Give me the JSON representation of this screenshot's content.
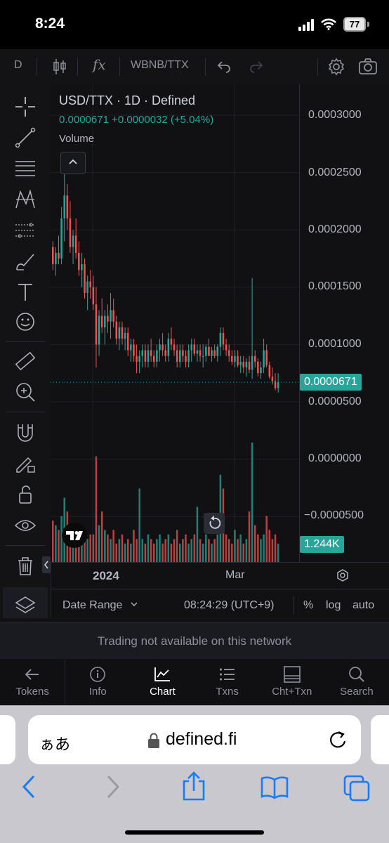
{
  "status": {
    "time": "8:24",
    "battery": "77"
  },
  "toolbar": {
    "interval": "D",
    "fx": "fx",
    "symbol": "WBNB/TTX"
  },
  "legend": {
    "title": "USD/TTX · 1D · Defined",
    "change": "0.0000671  +0.0000032 (+5.04%)",
    "volume": "Volume"
  },
  "price_axis": {
    "labels": [
      "0.0003000",
      "0.0002500",
      "0.0002000",
      "0.0001500",
      "0.0001000",
      "0.0000500",
      "0.0000000",
      "−0.0000500"
    ],
    "current_price": "0.0000671",
    "current_volume": "1.244K"
  },
  "time_axis": {
    "labels": [
      "2024",
      "Mar"
    ]
  },
  "range_bar": {
    "date_range": "Date Range",
    "clock": "08:24:29 (UTC+9)",
    "percent": "%",
    "log": "log",
    "auto": "auto"
  },
  "message": "Trading not available on this network",
  "nav": [
    {
      "label": "Tokens",
      "icon": "arrow-left-icon"
    },
    {
      "label": "Info",
      "icon": "info-icon"
    },
    {
      "label": "Chart",
      "icon": "chart-icon"
    },
    {
      "label": "Txns",
      "icon": "list-icon"
    },
    {
      "label": "Cht+Txn",
      "icon": "split-icon"
    },
    {
      "label": "Search",
      "icon": "search-icon"
    }
  ],
  "safari": {
    "aa": "ぁあ",
    "url": "defined.fi"
  },
  "colors": {
    "up": "#26a69a",
    "down": "#ef5350",
    "accent": "#26a69a"
  },
  "chart_data": {
    "type": "candlestick",
    "price_range": [
      -6e-05,
      0.00031
    ],
    "last_price": 6.71e-05,
    "candles": [
      [
        0.000185,
        0.00019,
        0.000165,
        0.00017
      ],
      [
        0.00017,
        0.000185,
        0.00016,
        0.00018
      ],
      [
        0.00018,
        0.000195,
        0.00017,
        0.000175
      ],
      [
        0.000175,
        0.00022,
        0.00017,
        0.00021
      ],
      [
        0.00021,
        0.00025,
        0.00019,
        0.00023
      ],
      [
        0.00023,
        0.00024,
        0.0002,
        0.00021
      ],
      [
        0.00021,
        0.000225,
        0.00018,
        0.000185
      ],
      [
        0.000185,
        0.0002,
        0.00017,
        0.000195
      ],
      [
        0.000195,
        0.00021,
        0.000175,
        0.00018
      ],
      [
        0.00018,
        0.00019,
        0.00016,
        0.000165
      ],
      [
        0.000165,
        0.00018,
        0.00015,
        0.00017
      ],
      [
        0.00017,
        0.000175,
        0.00014,
        0.000145
      ],
      [
        0.000145,
        0.00016,
        0.00013,
        0.000155
      ],
      [
        0.000155,
        0.000165,
        0.00014,
        0.00015
      ],
      [
        0.00015,
        0.00016,
        0.00013,
        0.000135
      ],
      [
        0.000135,
        0.00015,
        8e-05,
        0.0001
      ],
      [
        0.0001,
        0.00013,
        9e-05,
        0.000125
      ],
      [
        0.000125,
        0.00014,
        0.00011,
        0.000115
      ],
      [
        0.000115,
        0.00013,
        0.0001,
        0.000125
      ],
      [
        0.000125,
        0.000135,
        0.00011,
        0.00012
      ],
      [
        0.00012,
        0.000145,
        0.000105,
        0.00013
      ],
      [
        0.00013,
        0.00014,
        0.000115,
        0.00012
      ],
      [
        0.00012,
        0.000125,
        0.0001,
        0.000105
      ],
      [
        0.000105,
        0.00012,
        9.5e-05,
        0.000115
      ],
      [
        0.000115,
        0.00012,
        0.0001,
        0.000105
      ],
      [
        0.000105,
        0.000115,
        9.5e-05,
        0.00011
      ],
      [
        0.00011,
        0.000115,
        9e-05,
        9.5e-05
      ],
      [
        9.5e-05,
        0.000105,
        8.5e-05,
        0.0001
      ],
      [
        0.0001,
        0.000105,
        8.5e-05,
        9e-05
      ],
      [
        9e-05,
        0.0001,
        7.5e-05,
        8.5e-05
      ],
      [
        8.5e-05,
        9.5e-05,
        7.5e-05,
        9e-05
      ],
      [
        9e-05,
        0.0001,
        8e-05,
        9.5e-05
      ],
      [
        9.5e-05,
        0.0001,
        8e-05,
        8.5e-05
      ],
      [
        8.5e-05,
        0.0001,
        8e-05,
        9.5e-05
      ],
      [
        9.5e-05,
        0.000105,
        8.5e-05,
        9e-05
      ],
      [
        9e-05,
        9.5e-05,
        8e-05,
        8.5e-05
      ],
      [
        8.5e-05,
        0.0001,
        8e-05,
        9.5e-05
      ],
      [
        9.5e-05,
        0.000105,
        8.5e-05,
        0.0001
      ],
      [
        0.0001,
        0.00011,
        9e-05,
        9.5e-05
      ],
      [
        9.5e-05,
        0.0001,
        8.5e-05,
        9e-05
      ],
      [
        9e-05,
        0.00011,
        8.5e-05,
        0.000105
      ],
      [
        0.000105,
        0.000115,
        9.5e-05,
        0.0001
      ],
      [
        0.0001,
        0.000105,
        9e-05,
        9.5e-05
      ],
      [
        9.5e-05,
        0.0001,
        8e-05,
        8.5e-05
      ],
      [
        8.5e-05,
        0.0001,
        8e-05,
        9.5e-05
      ],
      [
        9.5e-05,
        0.0001,
        8.5e-05,
        9e-05
      ],
      [
        9e-05,
        9.5e-05,
        8e-05,
        8.5e-05
      ],
      [
        8.5e-05,
        0.0001,
        8e-05,
        9.5e-05
      ],
      [
        9.5e-05,
        0.000105,
        8.5e-05,
        0.0001
      ],
      [
        0.0001,
        0.000105,
        9e-05,
        9.2e-05
      ],
      [
        9.2e-05,
        0.0001,
        8.5e-05,
        9.5e-05
      ],
      [
        9.5e-05,
        0.0001,
        8.5e-05,
        9e-05
      ],
      [
        9e-05,
        0.0001,
        8e-05,
        9e-05
      ],
      [
        9e-05,
        0.0001,
        8.5e-05,
        9.8e-05
      ],
      [
        9.8e-05,
        0.000105,
        9e-05,
        9e-05
      ],
      [
        9e-05,
        9.8e-05,
        8.5e-05,
        9.5e-05
      ],
      [
        9.5e-05,
        0.0001,
        8.8e-05,
        9e-05
      ],
      [
        9e-05,
        0.0001,
        8.5e-05,
        9.8e-05
      ],
      [
        9.8e-05,
        0.000115,
        9e-05,
        0.00011
      ],
      [
        0.00011,
        0.000115,
        9.5e-05,
        0.0001
      ],
      [
        0.0001,
        0.000105,
        9e-05,
        9.5e-05
      ],
      [
        9.5e-05,
        0.0001,
        8.5e-05,
        9e-05
      ],
      [
        9e-05,
        9.5e-05,
        8.2e-05,
        8.5e-05
      ],
      [
        8.5e-05,
        9.5e-05,
        8e-05,
        9e-05
      ],
      [
        9e-05,
        9.5e-05,
        8e-05,
        8.2e-05
      ],
      [
        8.2e-05,
        9e-05,
        7.5e-05,
        8.5e-05
      ],
      [
        8.5e-05,
        9e-05,
        7.5e-05,
        8e-05
      ],
      [
        8e-05,
        8.8e-05,
        7.2e-05,
        8.5e-05
      ],
      [
        8.5e-05,
        9e-05,
        7.5e-05,
        7.8e-05
      ],
      [
        7.8e-05,
        0.000158,
        7e-05,
        9e-05
      ],
      [
        9e-05,
        9.5e-05,
        8e-05,
        8.5e-05
      ],
      [
        8.5e-05,
        8.8e-05,
        7.2e-05,
        7.5e-05
      ],
      [
        7.5e-05,
        8.5e-05,
        7e-05,
        8e-05
      ],
      [
        8e-05,
        0.000105,
        7.5e-05,
        9.5e-05
      ],
      [
        9.5e-05,
        0.0001,
        8e-05,
        8.2e-05
      ],
      [
        8.2e-05,
        8.5e-05,
        7e-05,
        7.2e-05
      ],
      [
        7.2e-05,
        8e-05,
        6.5e-05,
        6.8e-05
      ],
      [
        6.8e-05,
        7.5e-05,
        6e-05,
        6.2e-05
      ],
      [
        6.2e-05,
        7.5e-05,
        5.8e-05,
        6.71e-05
      ]
    ],
    "volumes": [
      0.45,
      0.4,
      0.35,
      0.5,
      0.7,
      0.55,
      0.3,
      0.35,
      0.3,
      0.25,
      0.3,
      0.35,
      0.25,
      0.3,
      0.3,
      1.15,
      0.4,
      0.55,
      0.35,
      0.3,
      0.25,
      0.35,
      0.2,
      0.25,
      0.3,
      0.2,
      0.25,
      0.2,
      0.35,
      0.25,
      0.8,
      0.25,
      0.2,
      0.3,
      0.25,
      0.2,
      0.25,
      0.3,
      0.2,
      0.25,
      0.3,
      0.2,
      0.25,
      0.35,
      0.2,
      0.25,
      0.3,
      0.2,
      0.25,
      0.3,
      0.6,
      0.25,
      0.2,
      0.3,
      0.25,
      0.2,
      0.25,
      0.3,
      0.95,
      0.8,
      0.3,
      0.25,
      0.2,
      0.35,
      0.25,
      0.3,
      0.2,
      0.25,
      0.55,
      1.3,
      0.4,
      0.3,
      0.25,
      0.3,
      0.5,
      0.35,
      0.25,
      0.3,
      0.2
    ]
  }
}
